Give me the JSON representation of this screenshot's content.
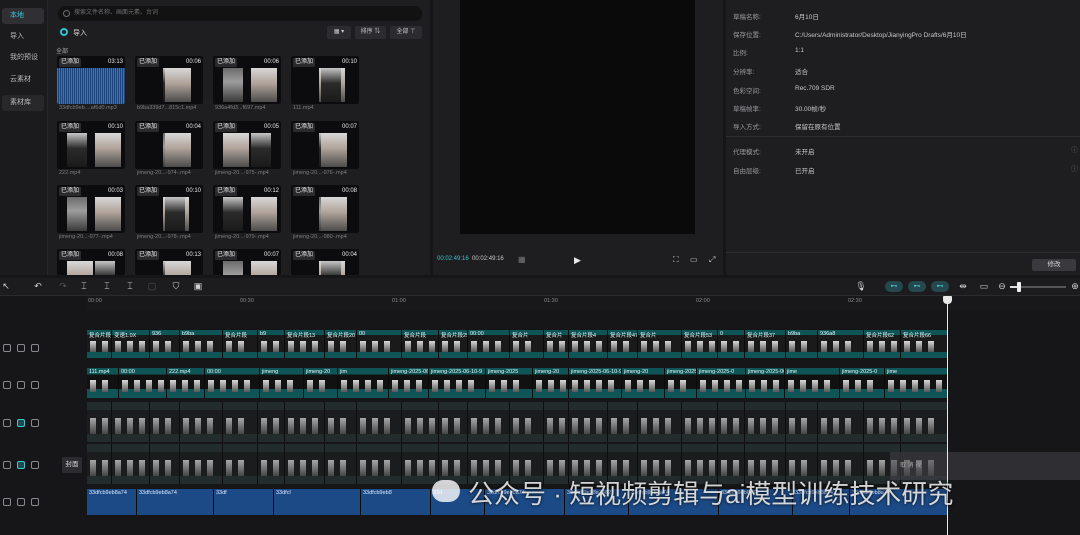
{
  "sidebar": {
    "items": [
      "本地",
      "导入",
      "我的预设",
      "云素材",
      "素材库"
    ]
  },
  "search": {
    "placeholder": "搜索文件名称、画面元素、台词"
  },
  "library": {
    "import_label": "导入",
    "sort_label": "排序",
    "filter_label": "全部",
    "all_label": "全部",
    "added_tag": "已添加",
    "items": [
      {
        "dur": "03:13",
        "name": "33dfcb9eb....af6d0.mp3",
        "kind": "audio"
      },
      {
        "dur": "00:06",
        "name": "b9ba339d7...815c1.mp4",
        "kind": "video"
      },
      {
        "dur": "00:06",
        "name": "936a4fd3...f697.mp4",
        "kind": "video"
      },
      {
        "dur": "00:10",
        "name": "111.mp4",
        "kind": "video"
      },
      {
        "dur": "00:10",
        "name": "222.mp4",
        "kind": "video"
      },
      {
        "dur": "00:04",
        "name": "jimeng-20...-974-.mp4",
        "kind": "video"
      },
      {
        "dur": "00:05",
        "name": "jimeng-20...-975-.mp4",
        "kind": "video"
      },
      {
        "dur": "00:07",
        "name": "jimeng-20...-976-.mp4",
        "kind": "video"
      },
      {
        "dur": "00:03",
        "name": "jimeng-20...-977-.mp4",
        "kind": "video"
      },
      {
        "dur": "00:10",
        "name": "jimeng-20...-978-.mp4",
        "kind": "video"
      },
      {
        "dur": "00:12",
        "name": "jimeng-20...-979-.mp4",
        "kind": "video"
      },
      {
        "dur": "00:08",
        "name": "jimeng-20...-980-.mp4",
        "kind": "video"
      },
      {
        "dur": "00:08",
        "name": "",
        "kind": "video"
      },
      {
        "dur": "00:13",
        "name": "",
        "kind": "video"
      },
      {
        "dur": "00:07",
        "name": "",
        "kind": "video"
      },
      {
        "dur": "00:04",
        "name": "",
        "kind": "video"
      }
    ]
  },
  "player": {
    "current_time": "00:02:49:16",
    "total_time": "00:02:49:16"
  },
  "details": {
    "rows": [
      {
        "label": "草稿名称:",
        "value": "6月10日"
      },
      {
        "label": "保存位置:",
        "value": "C:/Users/Administrator/Desktop/JianyingPro Drafts/6月10日"
      },
      {
        "label": "比例:",
        "value": "1:1"
      },
      {
        "label": "分辨率:",
        "value": "适合"
      },
      {
        "label": "色彩空间:",
        "value": "Rec.709 SDR"
      },
      {
        "label": "草稿帧率:",
        "value": "30.00帧/秒"
      },
      {
        "label": "导入方式:",
        "value": "保留在原有位置"
      }
    ],
    "rows2": [
      {
        "label": "代理模式:",
        "value": "未开启"
      },
      {
        "label": "自由层级:",
        "value": "已开启"
      }
    ],
    "modify_label": "修改"
  },
  "timeline": {
    "ticks": [
      "00:00",
      "00:30",
      "01:00",
      "01:30",
      "02:00",
      "02:30"
    ],
    "cover_label": "封面",
    "track1_clips": [
      "复合片段6",
      "变速1.0X",
      "936",
      "b9ba",
      "复合片段",
      "b9",
      "复合片段13",
      "复合片段20",
      "00",
      "复合片段",
      "复合片段29",
      "00:00",
      "复合片",
      "复合片",
      "复合片段4",
      "复合片段47",
      "复合片",
      "复合片段53",
      "0",
      "复合片段37",
      "b9ba",
      "936a8",
      "复合片段62",
      "复合片段66"
    ],
    "track2_clips": [
      "111.mp4",
      "00:00",
      "222.mp4",
      "00:00",
      "jimeng",
      "jimeng-20",
      "jim",
      "jimeng-2025-06",
      "jimeng-2025-06-10-9",
      "jimeng-2025",
      "jimeng-20",
      "jimeng-2025-06-10-9",
      "jimeng-20",
      "jimeng-2025",
      "jimeng-2025-0",
      "jimeng-2025-06",
      "jime",
      "jimeng-2025-0",
      "jime"
    ],
    "audio_clips": [
      "33dfcb9eb8a74",
      "33dfcb9eb8a74",
      "33df",
      "33dfcl",
      "33dfcb9eb8",
      "33d",
      "33dfcb9eb8a74",
      "33dfcb9eb8a7462",
      "33dfcb9eb8a74",
      "33dfcb9eb8a74",
      "33dfcb9eb8a74",
      "33dfcb9eb8a74"
    ],
    "ghost_label": "取 消 视"
  },
  "watermark": "公众号 · 短视频剪辑与ai模型训练技术研究"
}
